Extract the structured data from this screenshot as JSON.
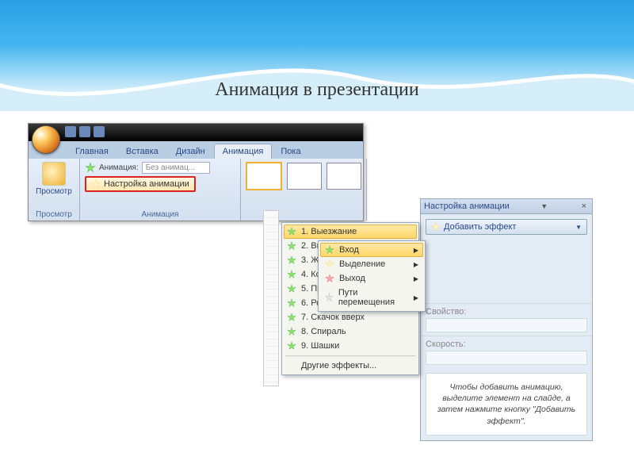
{
  "slide_title": "Анимация в презентации",
  "tabs": {
    "home": "Главная",
    "insert": "Вставка",
    "design": "Дизайн",
    "animation": "Анимация",
    "show": "Пока"
  },
  "ribbon": {
    "preview_btn": "Просмотр",
    "preview_group": "Просмотр",
    "anim_label": "Анимация:",
    "anim_combo": "Без анимац...",
    "custom_anim_btn": "Настройка анимации",
    "anim_group": "Анимация"
  },
  "taskpane": {
    "title": "Настройка анимации",
    "add_effect": "Добавить эффект",
    "menu": {
      "entrance": "Вход",
      "emphasis": "Выделение",
      "exit": "Выход",
      "motion": "Пути перемещения"
    },
    "entrance_items": [
      "1. Выезжание",
      "2. Вылет",
      "3. Жалюзи",
      "4. Колесо",
      "5. Прямоугольник",
      "6. Ромб",
      "7. Скачок вверх",
      "8. Спираль",
      "9. Шашки"
    ],
    "more_effects": "Другие эффекты...",
    "property_label": "Свойство:",
    "speed_label": "Скорость:",
    "hint": "Чтобы добавить анимацию, выделите элемент на слайде, а затем нажмите кнопку \"Добавить эффект\"."
  }
}
